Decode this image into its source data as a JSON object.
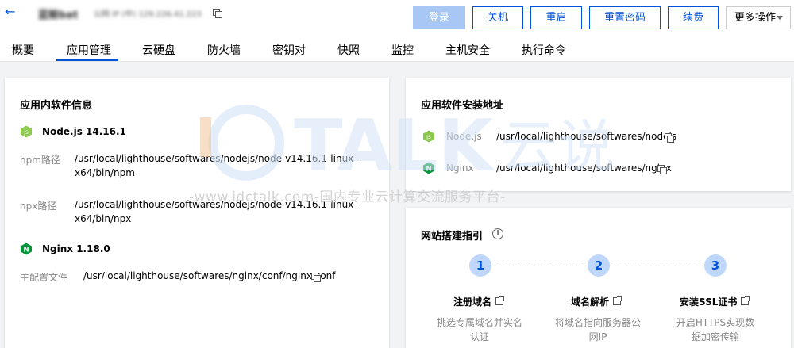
{
  "header": {
    "instance_name": "蓝鲸bat",
    "instance_ip": "公网 IP (中) 129.226.41.223",
    "buttons": {
      "login": "登录",
      "shutdown": "关机",
      "restart": "重启",
      "reset_password": "重置密码",
      "renew": "续费",
      "more": "更多操作"
    }
  },
  "tabs": [
    {
      "label": "概要"
    },
    {
      "label": "应用管理"
    },
    {
      "label": "云硬盘"
    },
    {
      "label": "防火墙"
    },
    {
      "label": "密钥对"
    },
    {
      "label": "快照"
    },
    {
      "label": "监控"
    },
    {
      "label": "主机安全"
    },
    {
      "label": "执行命令"
    }
  ],
  "active_tab": "应用管理",
  "software_info": {
    "title": "应用内软件信息",
    "node": {
      "name": "Node.js 14.16.1",
      "npm_label": "npm路径",
      "npm_path_line1": "/usr/local/lighthouse/softwares/nodejs/node-v14.16.1-linux-",
      "npm_path_line2": "x64/bin/npm",
      "npx_label": "npx路径",
      "npx_path_line1": "/usr/local/lighthouse/softwares/nodejs/node-v14.16.1-linux-",
      "npx_path_line2": "x64/bin/npx"
    },
    "nginx": {
      "name": "Nginx 1.18.0",
      "conf_label": "主配置文件",
      "conf_path": "/usr/local/lighthouse/softwares/nginx/conf/nginx.conf"
    }
  },
  "install_paths": {
    "title": "应用软件安装地址",
    "items": [
      {
        "name": "Node.js",
        "path": "/usr/local/lighthouse/softwares/nodejs"
      },
      {
        "name": "Nginx",
        "path": "/usr/local/lighthouse/softwares/nginx"
      }
    ]
  },
  "site_guide": {
    "title": "网站搭建指引",
    "steps": [
      {
        "num": "1",
        "title": "注册域名",
        "desc1": "挑选专属域名并实名",
        "desc2": "认证"
      },
      {
        "num": "2",
        "title": "域名解析",
        "desc1": "将域名指向服务器公",
        "desc2": "网IP"
      },
      {
        "num": "3",
        "title": "安装SSL证书",
        "desc1": "开启HTTPS实现数",
        "desc2": "据加密传输"
      }
    ]
  },
  "watermark": {
    "logo_text": "TALK",
    "logo_cn": "云说",
    "url_text": "-www.idctalk.com-国内专业云计算交流服务平台-"
  },
  "colors": {
    "primary": "#0052d9",
    "login_disabled": "#a8c7f4",
    "node_green": "#8cc84b",
    "nginx_green": "#009639",
    "step_bg": "#bed7fb"
  }
}
